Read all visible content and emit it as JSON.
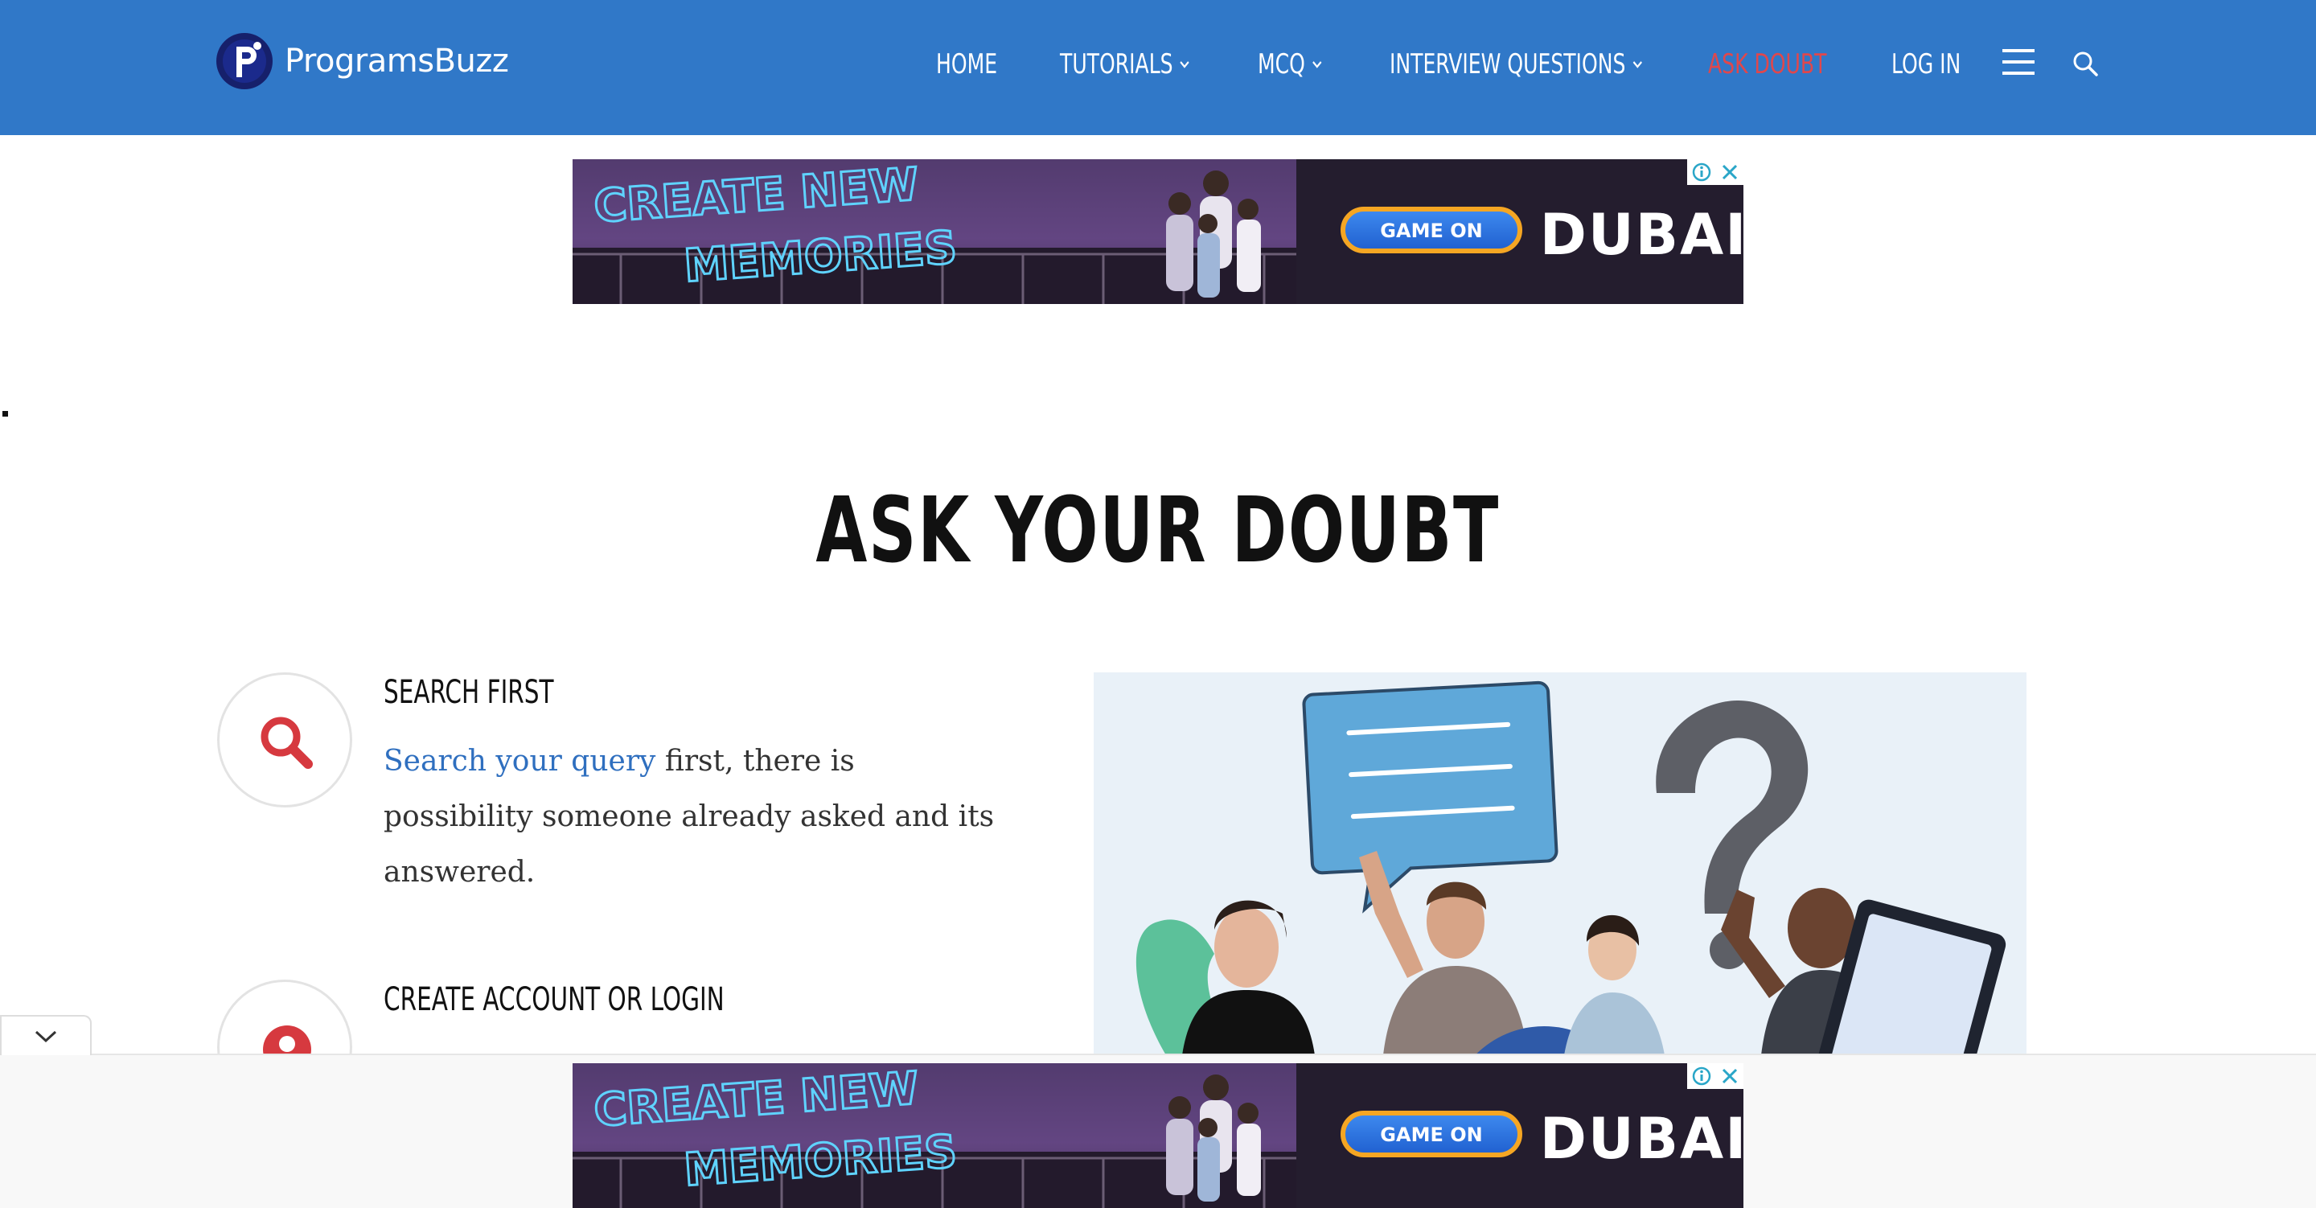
{
  "brand": {
    "name": "ProgramsBuzz",
    "color": "#3078c8"
  },
  "nav": {
    "items": [
      {
        "label": "HOME",
        "dropdown": false,
        "active": false
      },
      {
        "label": "TUTORIALS",
        "dropdown": true,
        "active": false
      },
      {
        "label": "MCQ",
        "dropdown": true,
        "active": false
      },
      {
        "label": "INTERVIEW QUESTIONS",
        "dropdown": true,
        "active": false
      },
      {
        "label": "ASK DOUBT",
        "dropdown": false,
        "active": true
      },
      {
        "label": "LOG IN",
        "dropdown": false,
        "active": false
      }
    ],
    "menu_icon": "hamburger-icon",
    "search_icon": "search-icon",
    "active_color": "#e0474c"
  },
  "ad": {
    "headline_line1": "CREATE NEW",
    "headline_line2": "MEMORIES",
    "cta": "GAME ON",
    "brand": "DUBAI"
  },
  "page": {
    "title": "ASK YOUR DOUBT"
  },
  "steps": [
    {
      "heading": "SEARCH FIRST",
      "link_text": "Search your query",
      "body_text": " first, there is possibility someone already asked and its answered.",
      "icon": "search-icon"
    },
    {
      "heading": "CREATE ACCOUNT OR LOGIN",
      "icon": "user-icon"
    }
  ],
  "accent_color": "#d6393f"
}
